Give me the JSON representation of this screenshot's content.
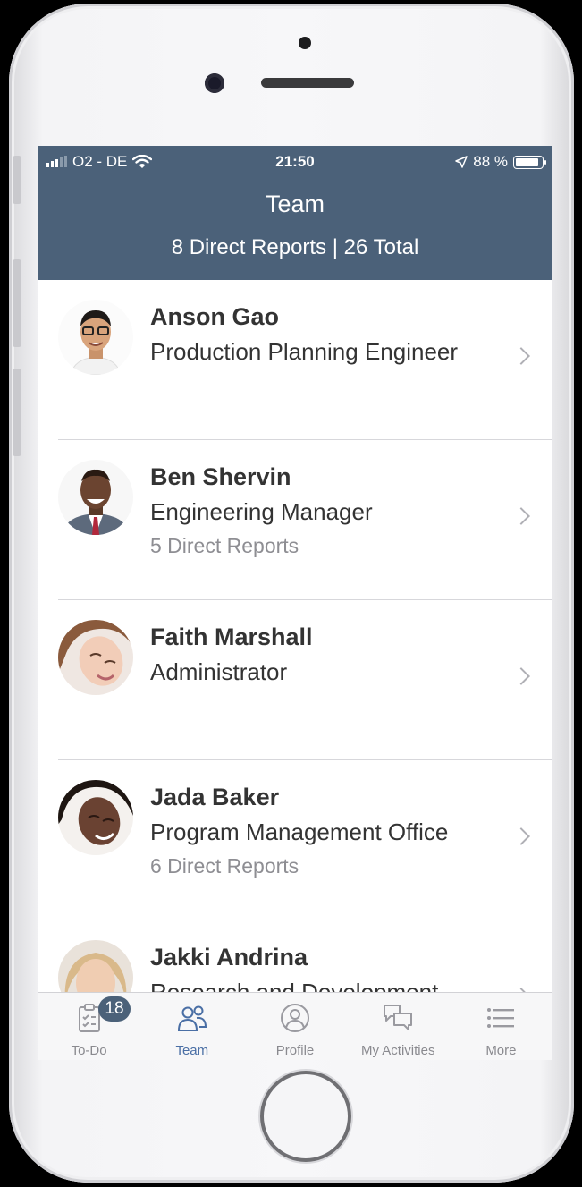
{
  "status_bar": {
    "carrier": "O2 - DE",
    "time": "21:50",
    "battery": "88 %",
    "battery_level": 0.88
  },
  "header": {
    "title": "Team",
    "subtitle": "8 Direct Reports | 26 Total"
  },
  "team": [
    {
      "name": "Anson Gao",
      "role": "Production Planning Engineer",
      "reports": ""
    },
    {
      "name": "Ben Shervin",
      "role": "Engineering Manager",
      "reports": "5 Direct Reports"
    },
    {
      "name": "Faith Marshall",
      "role": "Administrator",
      "reports": ""
    },
    {
      "name": "Jada Baker",
      "role": "Program Management Office",
      "reports": "6 Direct Reports"
    },
    {
      "name": "Jakki Andrina",
      "role": "Research and Development",
      "reports": ""
    }
  ],
  "tabs": [
    {
      "label": "To-Do",
      "icon": "clipboard-check-icon",
      "badge": "18"
    },
    {
      "label": "Team",
      "icon": "team-icon",
      "active": true
    },
    {
      "label": "Profile",
      "icon": "profile-icon"
    },
    {
      "label": "My Activities",
      "icon": "chat-bubbles-icon"
    },
    {
      "label": "More",
      "icon": "list-menu-icon"
    }
  ],
  "colors": {
    "header": "#4b6179",
    "active_tab": "#4a6fa5",
    "badge": "#4b6179"
  }
}
